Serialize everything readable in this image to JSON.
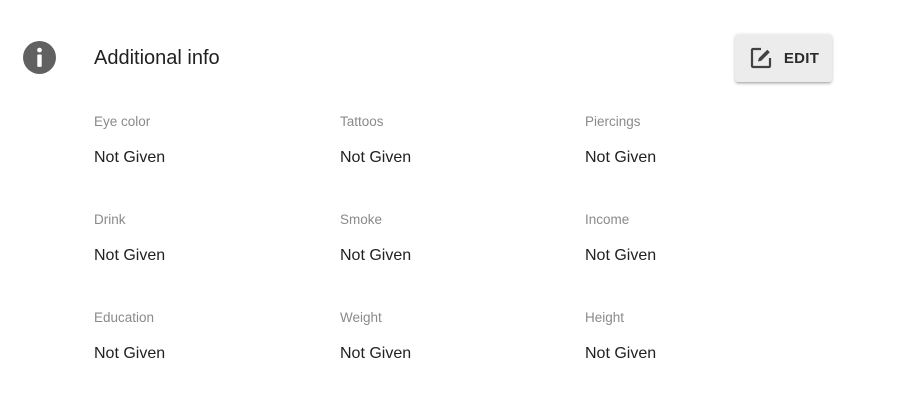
{
  "section": {
    "title": "Additional info",
    "icon": "info-icon"
  },
  "edit_button": {
    "label": "EDIT",
    "icon": "edit-icon"
  },
  "fields": [
    {
      "label": "Eye color",
      "value": "Not Given"
    },
    {
      "label": "Tattoos",
      "value": "Not Given"
    },
    {
      "label": "Piercings",
      "value": "Not Given"
    },
    {
      "label": "Drink",
      "value": "Not Given"
    },
    {
      "label": "Smoke",
      "value": "Not Given"
    },
    {
      "label": "Income",
      "value": "Not Given"
    },
    {
      "label": "Education",
      "value": "Not Given"
    },
    {
      "label": "Weight",
      "value": "Not Given"
    },
    {
      "label": "Height",
      "value": "Not Given"
    }
  ],
  "colors": {
    "icon": "#616161",
    "title": "#212121",
    "label": "#8a8a8a",
    "value": "#212121",
    "button_bg": "#ececec"
  }
}
